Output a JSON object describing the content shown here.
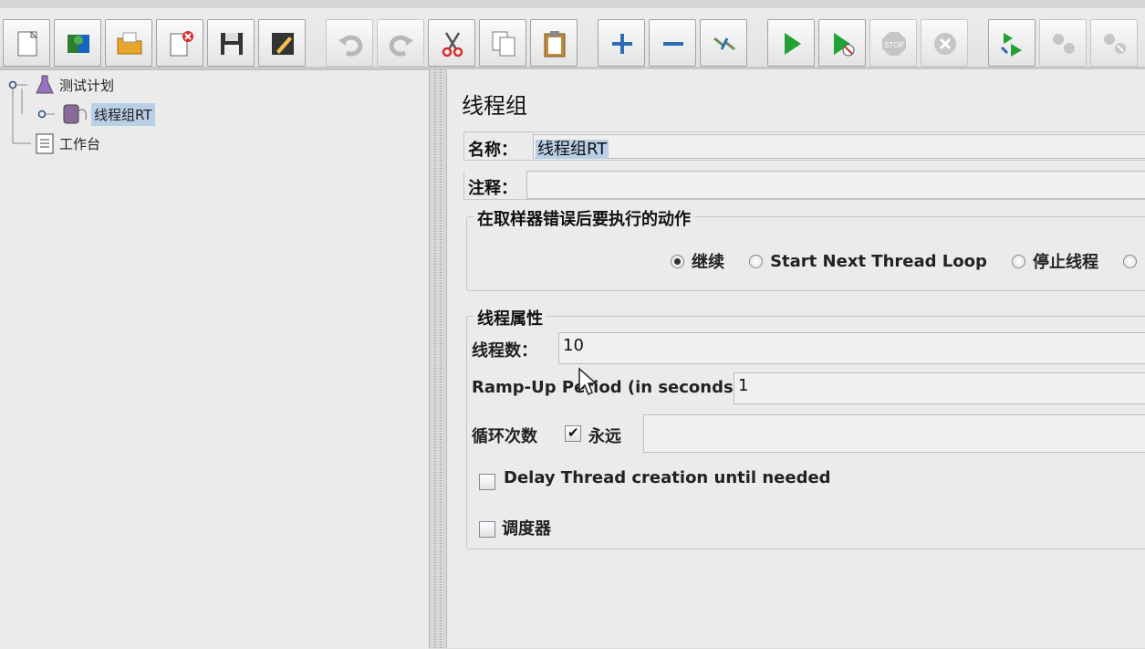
{
  "toolbar": {
    "buttons": [
      {
        "name": "new-button",
        "icon": "new-file-icon"
      },
      {
        "name": "templates-button",
        "icon": "templates-book-icon"
      },
      {
        "name": "open-button",
        "icon": "open-folder-icon"
      },
      {
        "name": "close-button",
        "icon": "close-file-icon"
      },
      {
        "name": "save-button",
        "icon": "floppy-disk-icon"
      },
      {
        "name": "edit-button",
        "icon": "edit-pencil-icon"
      },
      {
        "name": "undo-button",
        "icon": "undo-icon"
      },
      {
        "name": "redo-button",
        "icon": "redo-icon"
      },
      {
        "name": "cut-button",
        "icon": "scissors-icon"
      },
      {
        "name": "copy-button",
        "icon": "copy-icon"
      },
      {
        "name": "paste-button",
        "icon": "clipboard-icon"
      },
      {
        "name": "expand-button",
        "icon": "plus-icon"
      },
      {
        "name": "collapse-button",
        "icon": "minus-icon"
      },
      {
        "name": "toggle-button",
        "icon": "toggle-icon"
      },
      {
        "name": "start-button",
        "icon": "play-icon"
      },
      {
        "name": "start-no-pause-button",
        "icon": "play-no-timer-icon"
      },
      {
        "name": "stop-button",
        "icon": "stop-icon"
      },
      {
        "name": "shutdown-button",
        "icon": "shutdown-icon"
      },
      {
        "name": "remote-start-all-button",
        "icon": "remote-start-icon"
      },
      {
        "name": "remote-stop-all-button",
        "icon": "remote-stop-icon"
      },
      {
        "name": "remote-shutdown-all-button",
        "icon": "remote-shutdown-icon"
      }
    ]
  },
  "tree": {
    "test_plan": "测试计划",
    "thread_group": "线程组RT",
    "workbench": "工作台"
  },
  "panel": {
    "title": "线程组",
    "name_label": "名称：",
    "name_value": "线程组RT",
    "comment_label": "注释：",
    "comment_value": "",
    "error_action": {
      "legend": "在取样器错误后要执行的动作",
      "options": [
        "继续",
        "Start Next Thread Loop",
        "停止线程",
        ""
      ],
      "selected": "继续"
    },
    "thread_props": {
      "legend": "线程属性",
      "threads_label": "线程数：",
      "threads_value": "10",
      "rampup_label": "Ramp-Up Period (in seconds):",
      "rampup_value": "1",
      "loop_label": "循环次数",
      "forever_label": "永远",
      "forever_checked": true,
      "loop_value": "",
      "delay_label": "Delay Thread creation until needed",
      "delay_checked": false,
      "scheduler_label": "调度器",
      "scheduler_checked": false
    }
  }
}
